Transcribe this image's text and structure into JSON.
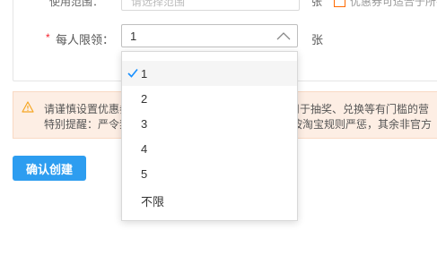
{
  "prev_row": {
    "label": "使用范围：",
    "placeholder": "请选择范围",
    "unit": "张",
    "tail_text": "优惠券可适合于所有商品"
  },
  "limit_row": {
    "required_mark": "*",
    "label": "每人限领：",
    "selected_value": "1",
    "unit": "张"
  },
  "dropdown": {
    "options": [
      "1",
      "2",
      "3",
      "4",
      "5",
      "不限"
    ],
    "selected_index": 0
  },
  "warning": {
    "line1_left": "请谨慎设置优惠券",
    "line1_right": "用于抽奖、兑换等有门槛的营",
    "line2_left": "特别提醒：严令禁",
    "line2_right": "按淘宝规则严惩，其余非官方"
  },
  "actions": {
    "confirm_label": "确认创建"
  },
  "colors": {
    "primary": "#2d9df0",
    "required": "#f5222d",
    "warning_bg": "#fdeee4",
    "warning_icon": "#f5a623",
    "check": "#1890ff"
  }
}
